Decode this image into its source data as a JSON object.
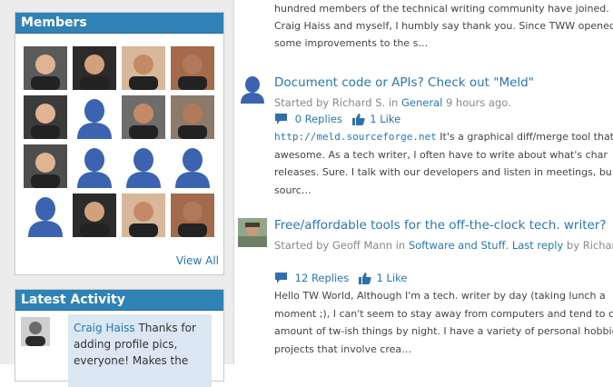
{
  "colors": {
    "accent": "#2f82b6",
    "link": "#2876b5",
    "sidebar_bg": "#ececec",
    "activity_bg": "#dbe7f2"
  },
  "members_widget": {
    "title": "Members",
    "view_all": "View All",
    "avatars": [
      {
        "name": "member-photo",
        "type": "photo"
      },
      {
        "name": "member-photo",
        "type": "photo"
      },
      {
        "name": "member-photo",
        "type": "photo"
      },
      {
        "name": "member-photo",
        "type": "photo"
      },
      {
        "name": "member-photo",
        "type": "photo"
      },
      {
        "name": "default-avatar-icon",
        "type": "default"
      },
      {
        "name": "member-photo",
        "type": "photo"
      },
      {
        "name": "member-photo",
        "type": "photo"
      },
      {
        "name": "member-photo",
        "type": "photo"
      },
      {
        "name": "default-avatar-icon",
        "type": "default"
      },
      {
        "name": "default-avatar-icon",
        "type": "default"
      },
      {
        "name": "default-avatar-icon",
        "type": "default"
      },
      {
        "name": "default-avatar-icon",
        "type": "default"
      },
      {
        "name": "member-photo",
        "type": "photo"
      },
      {
        "name": "member-photo",
        "type": "photo"
      },
      {
        "name": "member-photo",
        "type": "photo"
      }
    ]
  },
  "activity_widget": {
    "title": "Latest Activity",
    "item": {
      "user": "Craig Haiss",
      "text_1": " Thanks for",
      "text_2": "adding profile pics,",
      "text_3": "everyone! Makes the"
    }
  },
  "top_excerpt": {
    "lines": [
      "hundred members of the technical writing community have joined.",
      "Craig Haiss and myself, I humbly say thank you. Since TWW opened,",
      "some improvements to the s…"
    ]
  },
  "posts": [
    {
      "title": "Document code or APIs? Check out \"Meld\"",
      "meta_prefix": "Started by Richard S. in ",
      "category": "General",
      "meta_suffix": " 9 hours ago.",
      "replies": "0 Replies",
      "likes": "1 Like",
      "url": "http://meld.sourceforge.net",
      "body_first": "   It's a graphical diff/merge tool that",
      "body_lines": [
        "awesome. As a tech writer, I often have to write about what's char",
        "releases. Sure. I talk with our developers and listen in meetings, bu",
        "sourc…"
      ]
    },
    {
      "title": "Free/affordable tools for the off-the-clock tech. writer?",
      "meta_prefix": "Started by Geoff Mann in ",
      "category": "Software and Stuff.",
      "last_reply": "Last reply",
      "meta_suffix": " by Richard",
      "replies": "12 Replies",
      "likes": "1 Like",
      "body_lines": [
        "Hello TW World,   Although I'm a tech. writer by day (taking lunch a",
        "moment ;), I can't seem to stay away from computers and tend to c",
        "amount of tw-ish things by night. I have a variety of personal hobbie",
        "projects that involve crea…"
      ]
    }
  ]
}
